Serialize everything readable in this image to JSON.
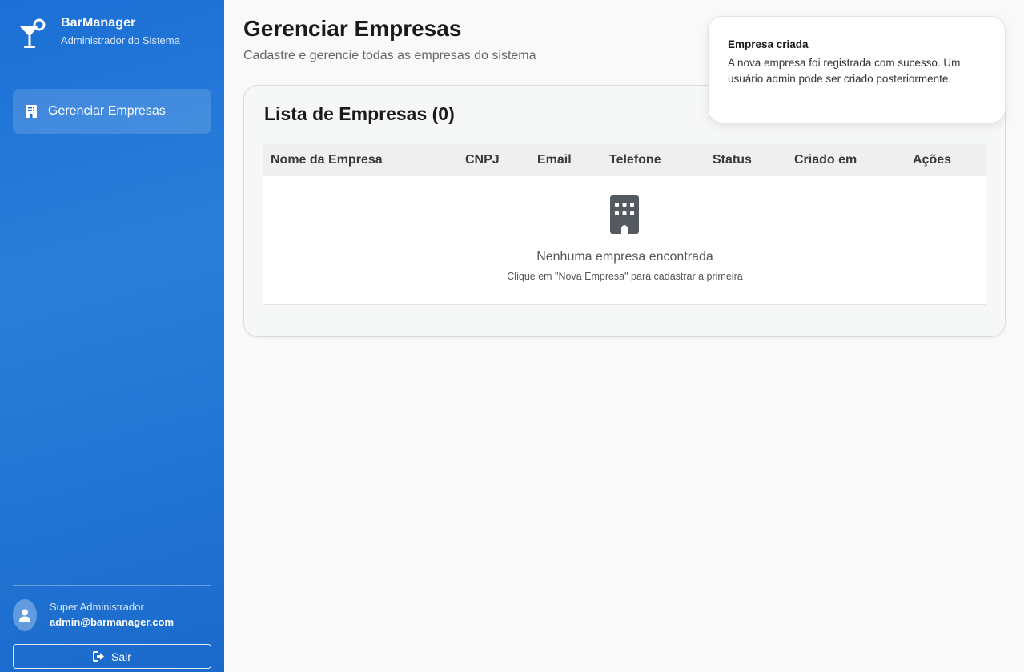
{
  "sidebar": {
    "app_name": "BarManager",
    "app_subtitle": "Administrador do Sistema",
    "logo_icon": "cocktail-icon",
    "nav": [
      {
        "label": "Gerenciar Empresas",
        "icon": "building-icon",
        "active": true
      }
    ],
    "user": {
      "role": "Super Administrador",
      "email": "admin@barmanager.com",
      "avatar_icon": "user-icon"
    },
    "logout_label": "Sair",
    "logout_icon": "sign-out-icon"
  },
  "header": {
    "title": "Gerenciar Empresas",
    "subtitle": "Cadastre e gerencie todas as empresas do sistema"
  },
  "companies_card": {
    "title": "Lista de Empresas (0)",
    "columns": [
      "Nome da Empresa",
      "CNPJ",
      "Email",
      "Telefone",
      "Status",
      "Criado em",
      "Ações"
    ],
    "empty_state": {
      "icon": "building-icon",
      "title": "Nenhuma empresa encontrada",
      "subtitle": "Clique em \"Nova Empresa\" para cadastrar a primeira"
    }
  },
  "toast": {
    "title": "Empresa criada",
    "message": "A nova empresa foi registrada com sucesso. Um usuário admin pode ser criado posteriormente."
  },
  "colors": {
    "sidebar_blue": "#1b6fd6",
    "page_bg": "#f9f9f9",
    "text_dark": "#1a1a1a"
  }
}
